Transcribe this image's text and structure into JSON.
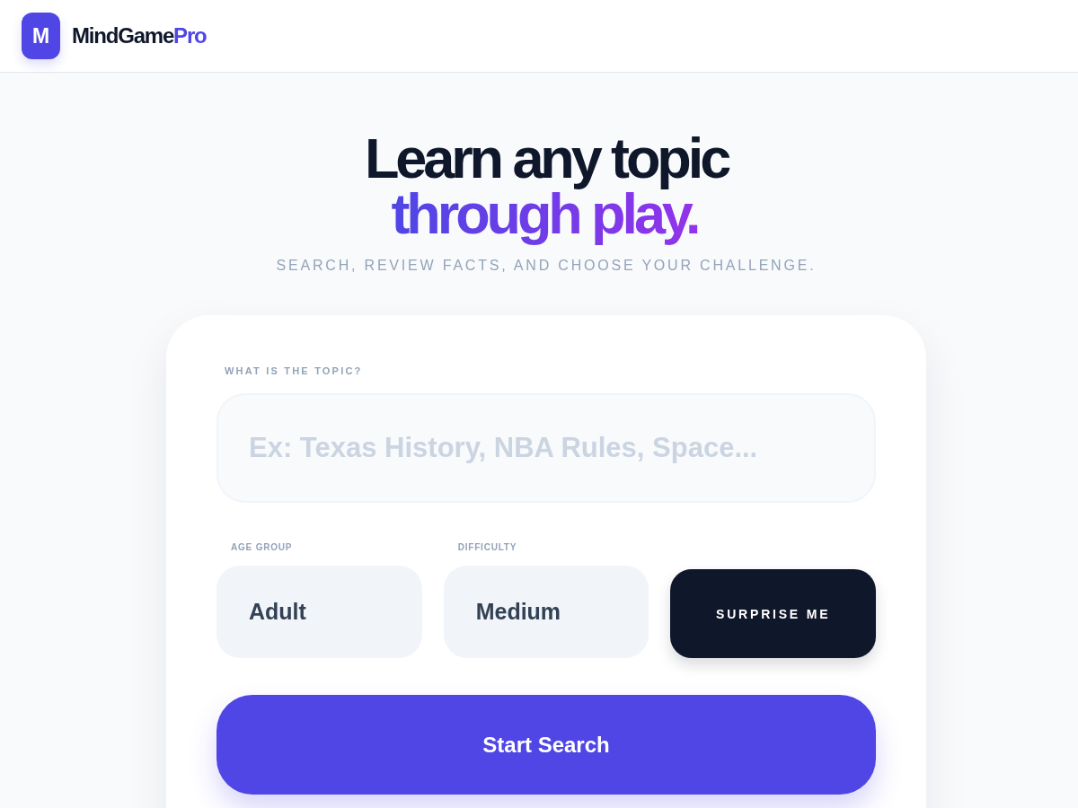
{
  "header": {
    "logo_letter": "M",
    "brand": {
      "name": "MindGame",
      "accent": "Pro"
    }
  },
  "hero": {
    "headline": {
      "lead": "Learn any topic",
      "accent": "through play."
    },
    "tagline": "SEARCH, REVIEW FACTS, AND CHOOSE YOUR CHALLENGE."
  },
  "form": {
    "topic": {
      "label": "WHAT IS THE TOPIC?",
      "placeholder": "Ex: Texas History, NBA Rules, Space..."
    },
    "options": [
      {
        "kind": "select",
        "label": "AGE GROUP",
        "value": "Adult"
      },
      {
        "kind": "select",
        "label": "DIFFICULTY",
        "value": "Medium"
      },
      {
        "kind": "button",
        "text": "SURPRISE ME"
      }
    ],
    "submit": "Start Search"
  }
}
